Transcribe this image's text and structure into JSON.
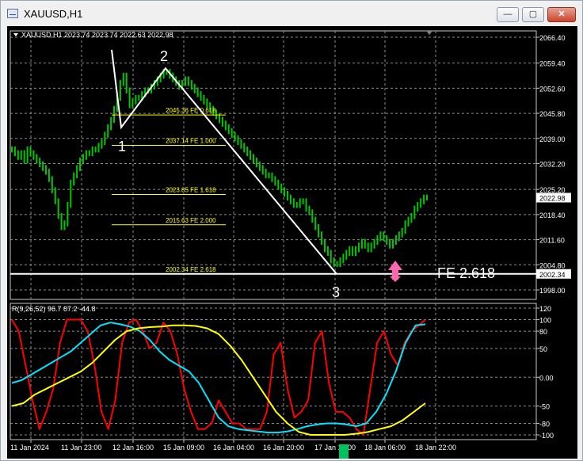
{
  "window": {
    "title": "XAUUSD,H1",
    "buttons": {
      "minimize": "—",
      "maximize": "▢",
      "close": "✕"
    }
  },
  "chart_data": [
    {
      "type": "candlestick",
      "title": "XAUUSD,H1  2023.74 2023.74 2022.63 2022.98",
      "ylim": [
        1998.0,
        2066.4
      ],
      "price_ticks": [
        "2066.40",
        "2059.40",
        "2052.60",
        "2045.80",
        "2039.00",
        "2032.20",
        "2025.20",
        "2018.40",
        "2011.60",
        "2004.80",
        "1998.00"
      ],
      "current_price": "2022.98",
      "line_price": "2002.34",
      "time_labels": [
        "11 Jan 2024",
        "11 Jan 23:00",
        "12 Jan 16:00",
        "15 Jan 09:00",
        "16 Jan 04:00",
        "16 Jan 20:00",
        "17 Jan 13:00",
        "18 Jan 06:00",
        "18 Jan 22:00"
      ],
      "close_series": [
        2036,
        2035,
        2034,
        2035,
        2033,
        2036,
        2035,
        2034,
        2033,
        2032,
        2031,
        2030,
        2028,
        2025,
        2022,
        2018,
        2015,
        2016,
        2021,
        2027,
        2029,
        2031,
        2033,
        2034,
        2035,
        2035,
        2036,
        2036,
        2037,
        2038,
        2040,
        2042,
        2044,
        2047,
        2050,
        2054,
        2056,
        2052,
        2048,
        2049,
        2050,
        2050,
        2051,
        2052,
        2052,
        2053,
        2054,
        2055,
        2056,
        2057,
        2057,
        2056,
        2055,
        2054,
        2053,
        2054,
        2055,
        2054,
        2053,
        2052,
        2051,
        2050,
        2049,
        2048,
        2047,
        2046,
        2045,
        2044,
        2043,
        2042,
        2041,
        2040,
        2039,
        2038,
        2037,
        2036,
        2035,
        2034,
        2033,
        2032,
        2031,
        2030,
        2029,
        2029,
        2028,
        2027,
        2026,
        2025,
        2024,
        2023,
        2022,
        2021,
        2021,
        2022,
        2022,
        2020,
        2019,
        2017,
        2015,
        2013,
        2011,
        2009,
        2008,
        2006,
        2005,
        2005,
        2006,
        2007,
        2008,
        2009,
        2008,
        2009,
        2010,
        2011,
        2010,
        2009,
        2010,
        2011,
        2012,
        2013,
        2012,
        2011,
        2010,
        2011,
        2012,
        2013,
        2014,
        2016,
        2017,
        2018,
        2020,
        2021,
        2022,
        2023,
        2023
      ],
      "fibo_levels": [
        {
          "label": "2045.36 FE 0.618",
          "price": 2045.36
        },
        {
          "label": "2037.14 FE 1.000",
          "price": 2037.14
        },
        {
          "label": "2023.85 FE 1.618",
          "price": 2023.85
        },
        {
          "label": "2015.63 FE 2.000",
          "price": 2015.63
        },
        {
          "label": "2002.34 FE 2.618",
          "price": 2002.34
        }
      ],
      "wave_points": [
        {
          "label": "",
          "price": 2063.0
        },
        {
          "label": "1",
          "price": 2042.0
        },
        {
          "label": "2",
          "price": 2058.0
        },
        {
          "label": "3",
          "price": 2002.3
        }
      ],
      "annotation": "FE  2.618",
      "arrow": "up"
    },
    {
      "type": "line",
      "title": "R(9,26,52) 96.7 87.2 -44.8",
      "ylim": [
        -100,
        120
      ],
      "ticks": [
        "120",
        "100",
        "80",
        "50",
        "0.00",
        "-50",
        "-80",
        "-100"
      ],
      "series": [
        {
          "name": "",
          "color": "#ff0000",
          "values": [
            100,
            80,
            20,
            -40,
            -90,
            -60,
            -20,
            60,
            100,
            100,
            100,
            80,
            20,
            -60,
            -90,
            -40,
            60,
            95,
            100,
            80,
            50,
            60,
            95,
            80,
            40,
            -20,
            -60,
            -90,
            -90,
            -80,
            -40,
            -60,
            -80,
            -80,
            -90,
            -90,
            -90,
            -60,
            40,
            60,
            -20,
            -70,
            -60,
            -40,
            60,
            80,
            -10,
            -60,
            -60,
            -70,
            -90,
            -100,
            -20,
            60,
            80,
            40,
            20,
            60,
            80,
            90,
            100
          ]
        },
        {
          "name": "",
          "color": "#00e5ff",
          "values": [
            -10,
            -5,
            5,
            15,
            25,
            35,
            45,
            60,
            75,
            90,
            95,
            92,
            88,
            80,
            65,
            45,
            30,
            20,
            10,
            -10,
            -40,
            -70,
            -85,
            -90,
            -92,
            -94,
            -96,
            -96,
            -94,
            -90,
            -85,
            -82,
            -80,
            -80,
            -82,
            -85,
            -80,
            -60,
            -30,
            10,
            60,
            90,
            92
          ]
        },
        {
          "name": "",
          "color": "#ffff00",
          "values": [
            -50,
            -45,
            -30,
            -20,
            -10,
            0,
            10,
            25,
            45,
            65,
            80,
            85,
            87,
            88,
            90,
            90,
            89,
            85,
            75,
            55,
            30,
            0,
            -30,
            -60,
            -80,
            -95,
            -100,
            -100,
            -100,
            -100,
            -98,
            -95,
            -90,
            -85,
            -75,
            -60,
            -45
          ]
        }
      ]
    }
  ]
}
